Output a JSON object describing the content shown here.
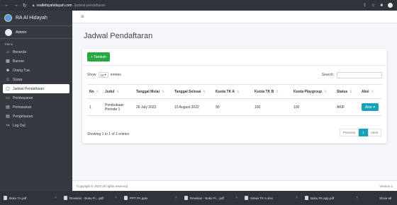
{
  "browser": {
    "url_host": "realfebiyahidayah.com",
    "url_path": "/jadwal-pendaftaran"
  },
  "sidebar": {
    "brand": "RA Al Hidayah",
    "user": "Admin",
    "menu_header": "Menu",
    "items": [
      {
        "label": "Beranda",
        "icon": "home-icon"
      },
      {
        "label": "Banner",
        "icon": "image-icon"
      },
      {
        "label": "Orang Tua",
        "icon": "users-icon"
      },
      {
        "label": "Siswa",
        "icon": "students-icon"
      },
      {
        "label": "Jadwal Pendaftaran",
        "icon": "calendar-icon",
        "active": true
      },
      {
        "label": "Pembayaran",
        "icon": "payment-icon"
      },
      {
        "label": "Pemasukan",
        "icon": "income-icon"
      },
      {
        "label": "Pengeluaran",
        "icon": "expense-icon"
      },
      {
        "label": "Log Out",
        "icon": "logout-icon"
      }
    ]
  },
  "main": {
    "title": "Jadwal Pendaftaran",
    "add_button": "+ Tambah",
    "show_label": "Show",
    "entries_value": "10",
    "entries_label": "entries",
    "search_label": "Search:",
    "search_value": "",
    "table": {
      "headers": [
        "No",
        "Judul",
        "Tanggal Mulai",
        "Tanggal Selesai",
        "Kuota TK A",
        "Kuota TK B",
        "Kuota Playgroup",
        "Status",
        "Aksi"
      ],
      "rows": [
        [
          "1",
          "Pembukaan Periode 1",
          "26 July 2022",
          "10 August 2022",
          "90",
          "100",
          "100",
          "AKIF",
          "Aksi"
        ]
      ]
    },
    "info": "Showing 1 to 1 of 1 entries",
    "pagination": {
      "prev": "Previous",
      "current": "1",
      "next": "Next"
    }
  },
  "footer": {
    "copyright": "Copyright © 2022 All rights reserved",
    "version": "Version 1"
  },
  "downloads": {
    "files": [
      "Buku TA.pdf",
      "Revisian - Buku Fi....pdf",
      "PPT PA.pptx",
      "Revisian - Buku Fi....pdf",
      "Siswa TK A.xlsx",
      "Buku PA app.pdf"
    ],
    "show_all": "Show all"
  },
  "colors": {
    "sidebar_bg": "#343a40",
    "add_button": "#28a745",
    "action_button": "#17a2b8"
  }
}
